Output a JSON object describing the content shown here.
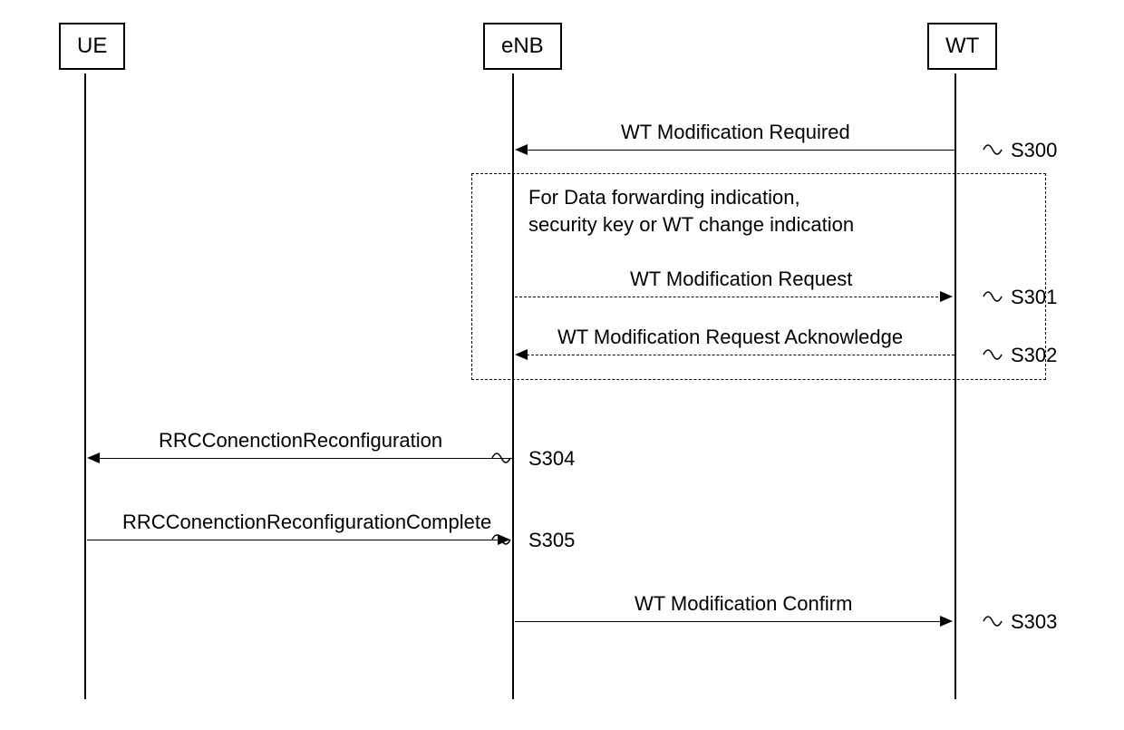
{
  "actors": {
    "ue": "UE",
    "enb": "eNB",
    "wt": "WT"
  },
  "box_note": {
    "line1": "For Data forwarding indication,",
    "line2": "security key or WT change indication"
  },
  "messages": {
    "m0": "WT Modification Required",
    "m1": "WT Modification Request",
    "m2": "WT Modification Request Acknowledge",
    "m3": "WT Modification Confirm",
    "m4": "RRCConenctionReconfiguration",
    "m5": "RRCConenctionReconfigurationComplete"
  },
  "steps": {
    "s0": "S300",
    "s1": "S301",
    "s2": "S302",
    "s3": "S303",
    "s4": "S304",
    "s5": "S305"
  }
}
